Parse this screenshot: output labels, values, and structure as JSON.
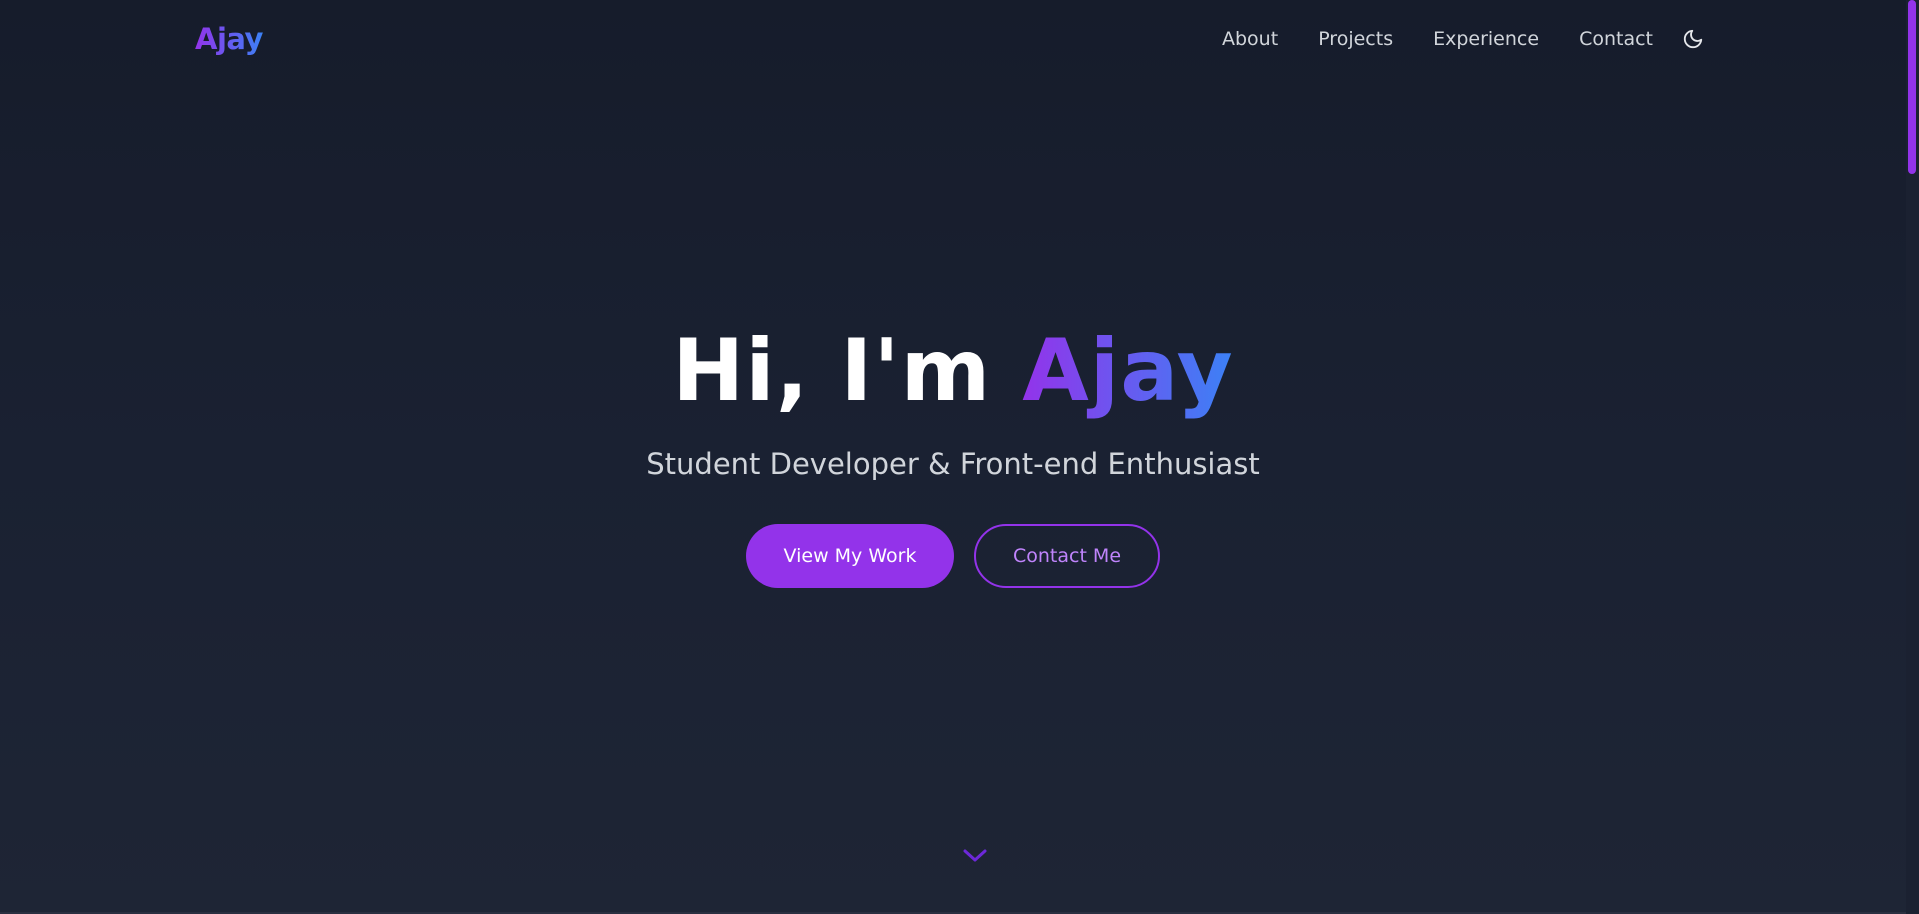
{
  "nav": {
    "logo": "Ajay",
    "links": [
      "About",
      "Projects",
      "Experience",
      "Contact"
    ],
    "theme_toggle_icon": "moon-icon"
  },
  "hero": {
    "greeting": "Hi, I'm ",
    "name": "Ajay",
    "subtitle": "Student Developer & Front-end Enthusiast",
    "primary_button": "View My Work",
    "secondary_button": "Contact Me",
    "scroll_icon": "chevron-down-icon"
  },
  "colors": {
    "accent_purple": "#9333ea",
    "accent_blue": "#3b82f6",
    "background": "#1a2132",
    "text_muted": "#d1d5db"
  }
}
